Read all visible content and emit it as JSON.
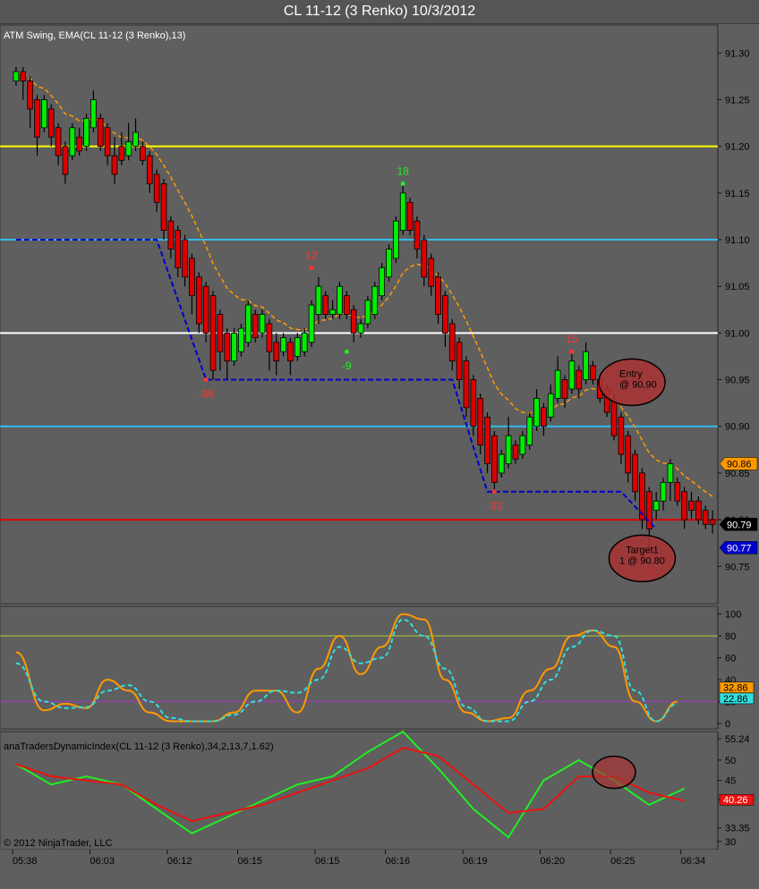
{
  "window": {
    "title": "CL 11-12 (3 Renko)  10/3/2012",
    "copyright": "© 2012 NinjaTrader, LLC"
  },
  "colors": {
    "background": "#5f5f5f",
    "up_candle": "#00ee00",
    "down_candle": "#dd0000",
    "ema": "#ff9900",
    "swing_line": "#0000cc",
    "yellow_line": "#ffff00",
    "cyan_line": "#33bbee",
    "white_line": "#ffffff",
    "red_line": "#dd0000",
    "stoch_k": "#ff9900",
    "stoch_d": "#33dddd",
    "tdi_green": "#22ee22",
    "tdi_red": "#ee1111",
    "circle_fill": "#aa3333"
  },
  "chart_data": [
    {
      "type": "candlestick",
      "panel": "price",
      "label": "ATM Swing, EMA(CL 11-12 (3 Renko),13)",
      "ylim": [
        90.71,
        91.33
      ],
      "y_ticks": [
        "91.30",
        "91.25",
        "91.20",
        "91.15",
        "91.10",
        "91.05",
        "91.00",
        "90.95",
        "90.90",
        "90.85",
        "90.80",
        "90.75"
      ],
      "x_ticks": [
        "05:38",
        "06:03",
        "06:12",
        "06:15",
        "06:15",
        "06:16",
        "06:19",
        "06:20",
        "06:25",
        "06:34"
      ],
      "bar_count": 100,
      "candles": [
        {
          "o": 91.27,
          "c": 91.28,
          "h": 91.285,
          "l": 91.265
        },
        {
          "o": 91.28,
          "c": 91.27,
          "h": 91.285,
          "l": 91.25
        },
        {
          "o": 91.27,
          "c": 91.24,
          "h": 91.275,
          "l": 91.22
        },
        {
          "o": 91.25,
          "c": 91.21,
          "h": 91.255,
          "l": 91.19
        },
        {
          "o": 91.22,
          "c": 91.25,
          "h": 91.255,
          "l": 91.215
        },
        {
          "o": 91.24,
          "c": 91.21,
          "h": 91.245,
          "l": 91.2
        },
        {
          "o": 91.22,
          "c": 91.19,
          "h": 91.225,
          "l": 91.18
        },
        {
          "o": 91.2,
          "c": 91.17,
          "h": 91.205,
          "l": 91.16
        },
        {
          "o": 91.19,
          "c": 91.22,
          "h": 91.225,
          "l": 91.185
        },
        {
          "o": 91.21,
          "c": 91.195,
          "h": 91.22,
          "l": 91.19
        },
        {
          "o": 91.2,
          "c": 91.23,
          "h": 91.235,
          "l": 91.195
        },
        {
          "o": 91.22,
          "c": 91.25,
          "h": 91.26,
          "l": 91.215
        },
        {
          "o": 91.23,
          "c": 91.2,
          "h": 91.235,
          "l": 91.195
        },
        {
          "o": 91.22,
          "c": 91.19,
          "h": 91.225,
          "l": 91.18
        },
        {
          "o": 91.19,
          "c": 91.17,
          "h": 91.21,
          "l": 91.16
        },
        {
          "o": 91.2,
          "c": 91.185,
          "h": 91.215,
          "l": 91.18
        },
        {
          "o": 91.19,
          "c": 91.205,
          "h": 91.225,
          "l": 91.185
        },
        {
          "o": 91.2,
          "c": 91.215,
          "h": 91.23,
          "l": 91.195
        },
        {
          "o": 91.2,
          "c": 91.185,
          "h": 91.205,
          "l": 91.18
        },
        {
          "o": 91.19,
          "c": 91.16,
          "h": 91.195,
          "l": 91.15
        },
        {
          "o": 91.17,
          "c": 91.14,
          "h": 91.175,
          "l": 91.13
        },
        {
          "o": 91.16,
          "c": 91.11,
          "h": 91.165,
          "l": 91.1
        },
        {
          "o": 91.12,
          "c": 91.09,
          "h": 91.125,
          "l": 91.08
        },
        {
          "o": 91.11,
          "c": 91.07,
          "h": 91.115,
          "l": 91.06
        },
        {
          "o": 91.1,
          "c": 91.06,
          "h": 91.105,
          "l": 91.05
        },
        {
          "o": 91.08,
          "c": 91.04,
          "h": 91.085,
          "l": 91.02
        },
        {
          "o": 91.06,
          "c": 91.01,
          "h": 91.065,
          "l": 91.0
        },
        {
          "o": 91.05,
          "c": 91.0,
          "h": 91.055,
          "l": 90.99
        },
        {
          "o": 91.04,
          "c": 90.96,
          "h": 91.045,
          "l": 90.95
        },
        {
          "o": 91.02,
          "c": 90.98,
          "h": 91.025,
          "l": 90.96
        },
        {
          "o": 91.0,
          "c": 90.97,
          "h": 91.005,
          "l": 90.95
        },
        {
          "o": 90.97,
          "c": 91.0,
          "h": 91.005,
          "l": 90.965
        },
        {
          "o": 90.98,
          "c": 91.005,
          "h": 91.01,
          "l": 90.975
        },
        {
          "o": 90.99,
          "c": 91.03,
          "h": 91.035,
          "l": 90.985
        },
        {
          "o": 91.02,
          "c": 90.995,
          "h": 91.025,
          "l": 90.99
        },
        {
          "o": 91.0,
          "c": 91.02,
          "h": 91.025,
          "l": 90.995
        },
        {
          "o": 91.01,
          "c": 90.98,
          "h": 91.015,
          "l": 90.96
        },
        {
          "o": 90.99,
          "c": 90.97,
          "h": 91.0,
          "l": 90.955
        },
        {
          "o": 90.98,
          "c": 90.995,
          "h": 91.0,
          "l": 90.975
        },
        {
          "o": 90.99,
          "c": 90.97,
          "h": 90.995,
          "l": 90.955
        },
        {
          "o": 90.975,
          "c": 90.995,
          "h": 91.0,
          "l": 90.97
        },
        {
          "o": 90.98,
          "c": 91.0,
          "h": 91.005,
          "l": 90.975
        },
        {
          "o": 90.99,
          "c": 91.03,
          "h": 91.035,
          "l": 90.985
        },
        {
          "o": 91.02,
          "c": 91.05,
          "h": 91.06,
          "l": 91.01
        },
        {
          "o": 91.04,
          "c": 91.02,
          "h": 91.045,
          "l": 91.015
        },
        {
          "o": 91.02,
          "c": 91.025,
          "h": 91.035,
          "l": 91.015
        },
        {
          "o": 91.02,
          "c": 91.05,
          "h": 91.055,
          "l": 91.015
        },
        {
          "o": 91.04,
          "c": 91.02,
          "h": 91.045,
          "l": 91.015
        },
        {
          "o": 91.025,
          "c": 91.0,
          "h": 91.03,
          "l": 90.99
        },
        {
          "o": 91.0,
          "c": 91.01,
          "h": 91.015,
          "l": 90.995
        },
        {
          "o": 91.01,
          "c": 91.035,
          "h": 91.04,
          "l": 91.005
        },
        {
          "o": 91.02,
          "c": 91.05,
          "h": 91.055,
          "l": 91.015
        },
        {
          "o": 91.04,
          "c": 91.07,
          "h": 91.075,
          "l": 91.035
        },
        {
          "o": 91.06,
          "c": 91.09,
          "h": 91.095,
          "l": 91.055
        },
        {
          "o": 91.08,
          "c": 91.12,
          "h": 91.125,
          "l": 91.075
        },
        {
          "o": 91.11,
          "c": 91.15,
          "h": 91.16,
          "l": 91.105
        },
        {
          "o": 91.14,
          "c": 91.11,
          "h": 91.145,
          "l": 91.105
        },
        {
          "o": 91.12,
          "c": 91.09,
          "h": 91.125,
          "l": 91.08
        },
        {
          "o": 91.1,
          "c": 91.06,
          "h": 91.105,
          "l": 91.05
        },
        {
          "o": 91.08,
          "c": 91.05,
          "h": 91.085,
          "l": 91.04
        },
        {
          "o": 91.06,
          "c": 91.02,
          "h": 91.065,
          "l": 91.01
        },
        {
          "o": 91.04,
          "c": 91.0,
          "h": 91.045,
          "l": 90.985
        },
        {
          "o": 91.01,
          "c": 90.97,
          "h": 91.015,
          "l": 90.96
        },
        {
          "o": 90.99,
          "c": 90.95,
          "h": 90.995,
          "l": 90.94
        },
        {
          "o": 90.97,
          "c": 90.92,
          "h": 90.975,
          "l": 90.91
        },
        {
          "o": 90.95,
          "c": 90.9,
          "h": 90.955,
          "l": 90.89
        },
        {
          "o": 90.93,
          "c": 90.88,
          "h": 90.935,
          "l": 90.87
        },
        {
          "o": 90.91,
          "c": 90.86,
          "h": 90.915,
          "l": 90.85
        },
        {
          "o": 90.89,
          "c": 90.84,
          "h": 90.895,
          "l": 90.83
        },
        {
          "o": 90.85,
          "c": 90.87,
          "h": 90.875,
          "l": 90.845
        },
        {
          "o": 90.86,
          "c": 90.89,
          "h": 90.91,
          "l": 90.855
        },
        {
          "o": 90.88,
          "c": 90.865,
          "h": 90.885,
          "l": 90.86
        },
        {
          "o": 90.87,
          "c": 90.89,
          "h": 90.895,
          "l": 90.865
        },
        {
          "o": 90.88,
          "c": 90.91,
          "h": 90.915,
          "l": 90.875
        },
        {
          "o": 90.9,
          "c": 90.93,
          "h": 90.94,
          "l": 90.895
        },
        {
          "o": 90.92,
          "c": 90.9,
          "h": 90.925,
          "l": 90.89
        },
        {
          "o": 90.91,
          "c": 90.935,
          "h": 90.945,
          "l": 90.905
        },
        {
          "o": 90.93,
          "c": 90.96,
          "h": 90.975,
          "l": 90.925
        },
        {
          "o": 90.95,
          "c": 90.93,
          "h": 90.955,
          "l": 90.92
        },
        {
          "o": 90.94,
          "c": 90.97,
          "h": 90.98,
          "l": 90.935
        },
        {
          "o": 90.96,
          "c": 90.94,
          "h": 90.965,
          "l": 90.93
        },
        {
          "o": 90.95,
          "c": 90.98,
          "h": 90.99,
          "l": 90.945
        },
        {
          "o": 90.965,
          "c": 90.95,
          "h": 90.97,
          "l": 90.945
        },
        {
          "o": 90.95,
          "c": 90.93,
          "h": 90.955,
          "l": 90.925
        },
        {
          "o": 90.94,
          "c": 90.915,
          "h": 90.945,
          "l": 90.91
        },
        {
          "o": 90.93,
          "c": 90.89,
          "h": 90.935,
          "l": 90.885
        },
        {
          "o": 90.91,
          "c": 90.87,
          "h": 90.915,
          "l": 90.86
        },
        {
          "o": 90.89,
          "c": 90.85,
          "h": 90.895,
          "l": 90.84
        },
        {
          "o": 90.87,
          "c": 90.83,
          "h": 90.875,
          "l": 90.82
        },
        {
          "o": 90.85,
          "c": 90.8,
          "h": 90.855,
          "l": 90.79
        },
        {
          "o": 90.83,
          "c": 90.79,
          "h": 90.835,
          "l": 90.77
        },
        {
          "o": 90.81,
          "c": 90.82,
          "h": 90.83,
          "l": 90.8
        },
        {
          "o": 90.82,
          "c": 90.84,
          "h": 90.845,
          "l": 90.81
        },
        {
          "o": 90.84,
          "c": 90.86,
          "h": 90.865,
          "l": 90.82
        },
        {
          "o": 90.84,
          "c": 90.82,
          "h": 90.845,
          "l": 90.815
        },
        {
          "o": 90.83,
          "c": 90.8,
          "h": 90.835,
          "l": 90.79
        },
        {
          "o": 90.82,
          "c": 90.81,
          "h": 90.83,
          "l": 90.8
        },
        {
          "o": 90.82,
          "c": 90.8,
          "h": 90.825,
          "l": 90.795
        },
        {
          "o": 90.81,
          "c": 90.795,
          "h": 90.815,
          "l": 90.79
        },
        {
          "o": 90.8,
          "c": 90.795,
          "h": 90.81,
          "l": 90.785
        }
      ],
      "horizontal_lines": [
        {
          "value": 91.2,
          "color": "#ffff00"
        },
        {
          "value": 91.1,
          "color": "#33bbee"
        },
        {
          "value": 91.0,
          "color": "#ffffff"
        },
        {
          "value": 90.9,
          "color": "#33bbee"
        },
        {
          "value": 90.8,
          "color": "#dd0000"
        }
      ],
      "swing_segments": [
        [
          [
            0,
            91.1
          ],
          [
            20,
            91.1
          ],
          [
            27,
            90.95
          ],
          [
            62,
            90.95
          ],
          [
            67,
            90.83
          ],
          [
            86,
            90.83
          ],
          [
            91,
            90.79
          ]
        ]
      ],
      "swing_labels": [
        {
          "text": "-36",
          "bar": 27,
          "value": 90.95,
          "color": "#ff3333"
        },
        {
          "text": "12",
          "bar": 42,
          "value": 91.07,
          "color": "#ff3333"
        },
        {
          "text": "-9",
          "bar": 47,
          "value": 90.98,
          "color": "#22ee22"
        },
        {
          "text": "18",
          "bar": 55,
          "value": 91.16,
          "color": "#22ee22"
        },
        {
          "text": "-33",
          "bar": 68,
          "value": 90.83,
          "color": "#ff3333"
        },
        {
          "text": "15",
          "bar": 79,
          "value": 90.98,
          "color": "#ff3333"
        },
        {
          "text": "-21",
          "bar": 90,
          "value": 90.76,
          "color": "#ff3333"
        }
      ],
      "annotations": [
        {
          "lines": [
            "Entry",
            "@ 90.90"
          ],
          "bar": 85,
          "value": 90.955
        },
        {
          "lines": [
            "Target1",
            "1 @ 90.80"
          ],
          "bar": 89,
          "value": 90.77
        }
      ],
      "price_markers": [
        {
          "text": "90.86",
          "value": 90.86,
          "bg": "#ff9900",
          "fg": "#000000"
        },
        {
          "text": "90.79",
          "value": 90.795,
          "bg": "#000000",
          "fg": "#ffffff"
        },
        {
          "text": "90.77",
          "value": 90.77,
          "bg": "#0000cc",
          "fg": "#ffffff"
        }
      ]
    },
    {
      "type": "line",
      "panel": "stochastic",
      "ylim": [
        -5,
        107
      ],
      "y_ticks": [
        "100",
        "80",
        "60",
        "40",
        "20",
        "0"
      ],
      "hlines": [
        {
          "value": 80,
          "color": "#aacc33"
        },
        {
          "value": 20,
          "color": "#aa33cc"
        }
      ],
      "series": [
        {
          "values_bar": [
            0,
            4,
            7,
            10,
            13,
            16,
            19,
            22,
            25,
            28,
            31,
            34,
            37,
            40,
            43,
            46,
            49,
            52,
            55,
            58,
            61,
            64,
            67,
            70,
            73,
            76,
            79,
            82,
            85,
            88,
            91,
            94
          ],
          "values": [
            65,
            12,
            18,
            14,
            40,
            30,
            10,
            2,
            2,
            2,
            10,
            30,
            30,
            10,
            50,
            80,
            45,
            70,
            100,
            95,
            40,
            10,
            2,
            5,
            30,
            50,
            80,
            85,
            70,
            20,
            2,
            20
          ]
        },
        {
          "values_bar": [
            0,
            4,
            7,
            10,
            13,
            16,
            19,
            22,
            25,
            28,
            31,
            34,
            37,
            40,
            43,
            46,
            49,
            52,
            55,
            58,
            61,
            64,
            67,
            70,
            73,
            76,
            79,
            82,
            85,
            88,
            91,
            94
          ],
          "values": [
            55,
            20,
            14,
            15,
            30,
            35,
            20,
            5,
            2,
            2,
            8,
            20,
            30,
            28,
            40,
            70,
            55,
            60,
            95,
            80,
            50,
            15,
            2,
            2,
            20,
            40,
            70,
            85,
            80,
            30,
            2,
            18
          ]
        }
      ],
      "value_markers": [
        {
          "text": "32.86",
          "value": 32.86,
          "bg": "#ff9900"
        },
        {
          "text": "22.86",
          "value": 22.86,
          "bg": "#33dddd"
        }
      ]
    },
    {
      "type": "line",
      "panel": "tdi",
      "label": "anaTradersDynamicIndex(CL 11-12 (3 Renko),34,2,13,7,1.62)",
      "ylim": [
        28,
        57
      ],
      "y_ticks": [
        "55.24",
        "50",
        "45",
        "40.26",
        "33.35",
        "30"
      ],
      "series": [
        {
          "values_bar": [
            0,
            5,
            10,
            15,
            20,
            25,
            30,
            35,
            40,
            45,
            50,
            55,
            60,
            65,
            70,
            75,
            80,
            85,
            90,
            95
          ],
          "values": [
            49,
            44,
            46,
            44,
            38,
            32,
            36,
            40,
            44,
            46,
            52,
            57,
            48,
            38,
            31,
            45,
            50,
            45,
            39,
            43
          ]
        },
        {
          "values_bar": [
            0,
            5,
            10,
            15,
            20,
            25,
            30,
            35,
            40,
            45,
            50,
            55,
            60,
            65,
            70,
            75,
            80,
            85,
            90,
            95
          ],
          "values": [
            49,
            46,
            45,
            44,
            39,
            35,
            37,
            39,
            42,
            45,
            48,
            53,
            51,
            44,
            37,
            38,
            46,
            46,
            42,
            40
          ]
        }
      ],
      "value_markers": [
        {
          "text": "40.26",
          "value": 40.26,
          "bg": "#ee1111"
        }
      ]
    }
  ]
}
